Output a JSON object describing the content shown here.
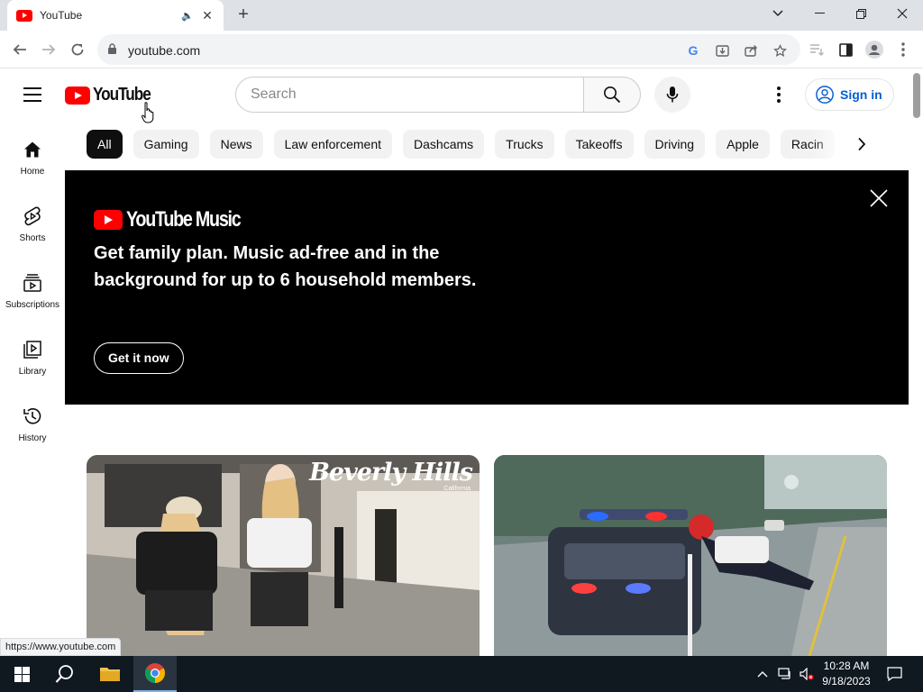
{
  "browser": {
    "tab_title": "YouTube",
    "url": "youtube.com",
    "status_url": "https://www.youtube.com"
  },
  "masthead": {
    "logo_text": "YouTube",
    "search_placeholder": "Search",
    "sign_in_label": "Sign in"
  },
  "chips": [
    "All",
    "Gaming",
    "News",
    "Law enforcement",
    "Dashcams",
    "Trucks",
    "Takeoffs",
    "Driving",
    "Apple",
    "Racin"
  ],
  "guide": {
    "items": [
      {
        "label": "Home",
        "icon": "home-icon"
      },
      {
        "label": "Shorts",
        "icon": "shorts-icon"
      },
      {
        "label": "Subscriptions",
        "icon": "subscriptions-icon"
      },
      {
        "label": "Library",
        "icon": "library-icon"
      },
      {
        "label": "History",
        "icon": "history-icon"
      }
    ]
  },
  "banner": {
    "logo_text": "YouTube Music",
    "headline": "Get family plan. Music ad-free and in the background for up to 6 household members.",
    "cta_label": "Get it now"
  },
  "thumbnails": [
    {
      "overlay_text": "Beverly Hills",
      "overlay_sub": "California"
    },
    {
      "overlay_text": ""
    }
  ],
  "taskbar": {
    "time": "10:28 AM",
    "date": "9/18/2023"
  },
  "colors": {
    "brand_red": "#ff0000",
    "link_blue": "#065fd4",
    "chip_active": "#0f0f0f"
  }
}
